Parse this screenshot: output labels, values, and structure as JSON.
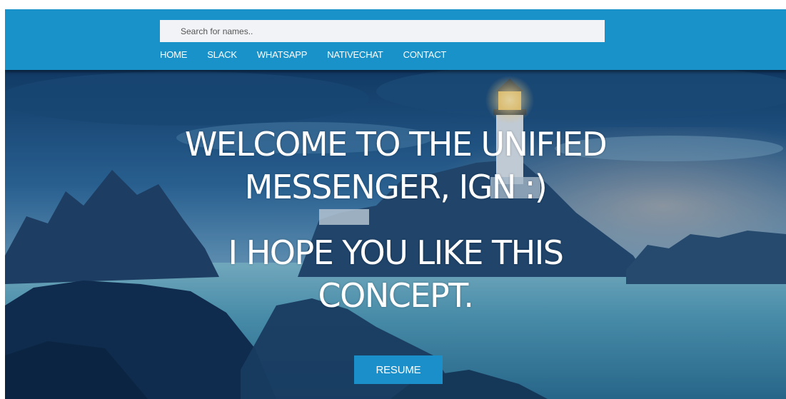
{
  "search": {
    "placeholder": "Search for names.."
  },
  "nav": {
    "items": [
      {
        "label": "HOME"
      },
      {
        "label": "SLACK"
      },
      {
        "label": "WHATSAPP"
      },
      {
        "label": "NATIVECHAT"
      },
      {
        "label": "CONTACT"
      }
    ]
  },
  "hero": {
    "welcome_line1": "WELCOME TO THE UNIFIED",
    "welcome_line2": "MESSENGER, IGN :)",
    "hope_line1": "I HOPE YOU LIKE THIS",
    "hope_line2": "CONCEPT.",
    "resume_label": "RESUME"
  },
  "colors": {
    "header": "#1991c9",
    "button": "#1b8fca",
    "text": "#ffffff"
  },
  "background": {
    "image": "lighthouse-seascape-photo"
  }
}
